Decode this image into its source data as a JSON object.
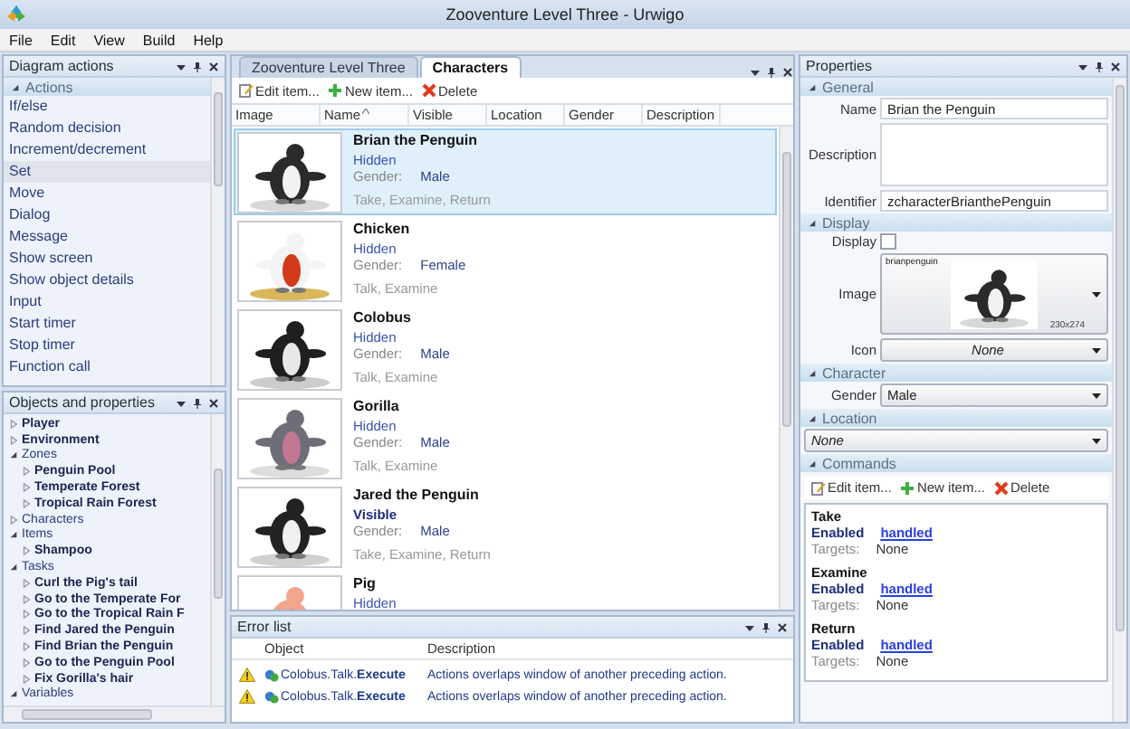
{
  "window": {
    "title": "Zooventure Level Three - Urwigo"
  },
  "menu": [
    "File",
    "Edit",
    "View",
    "Build",
    "Help"
  ],
  "diagram_actions": {
    "title": "Diagram actions",
    "section": {
      "label": "Actions",
      "expanded": true
    },
    "items": [
      {
        "label": "If/else",
        "selected": false
      },
      {
        "label": "Random decision",
        "selected": false
      },
      {
        "label": "Increment/decrement",
        "selected": false
      },
      {
        "label": "Set",
        "selected": true
      },
      {
        "label": "Move",
        "selected": false
      },
      {
        "label": "Dialog",
        "selected": false
      },
      {
        "label": "Message",
        "selected": false
      },
      {
        "label": "Show screen",
        "selected": false
      },
      {
        "label": "Show object details",
        "selected": false
      },
      {
        "label": "Input",
        "selected": false
      },
      {
        "label": "Start timer",
        "selected": false
      },
      {
        "label": "Stop timer",
        "selected": false
      },
      {
        "label": "Function call",
        "selected": false
      }
    ]
  },
  "objects": {
    "title": "Objects and properties",
    "tree": [
      {
        "label": "Player",
        "kind": "object",
        "expanded": false
      },
      {
        "label": "Environment",
        "kind": "object",
        "expanded": false
      },
      {
        "label": "Zones",
        "kind": "group",
        "expanded": true,
        "children": [
          {
            "label": "Penguin Pool",
            "kind": "object",
            "expanded": false
          },
          {
            "label": "Temperate Forest",
            "kind": "object",
            "expanded": false
          },
          {
            "label": "Tropical Rain Forest",
            "kind": "object",
            "expanded": false
          }
        ]
      },
      {
        "label": "Characters",
        "kind": "group",
        "expanded": false
      },
      {
        "label": "Items",
        "kind": "group",
        "expanded": true,
        "children": [
          {
            "label": "Shampoo",
            "kind": "object",
            "expanded": false
          }
        ]
      },
      {
        "label": "Tasks",
        "kind": "group",
        "expanded": true,
        "children": [
          {
            "label": "Curl the Pig's tail",
            "kind": "object",
            "expanded": false
          },
          {
            "label": "Go to the Temperate For",
            "kind": "object",
            "expanded": false
          },
          {
            "label": "Go to the Tropical Rain F",
            "kind": "object",
            "expanded": false
          },
          {
            "label": "Find Jared the Penguin",
            "kind": "object",
            "expanded": false
          },
          {
            "label": "Find Brian the Penguin",
            "kind": "object",
            "expanded": false
          },
          {
            "label": "Go to the Penguin Pool",
            "kind": "object",
            "expanded": false
          },
          {
            "label": "Fix Gorilla's hair",
            "kind": "object",
            "expanded": false
          }
        ]
      },
      {
        "label": "Variables",
        "kind": "group",
        "expanded": true
      }
    ]
  },
  "document": {
    "tabs": [
      {
        "label": "Zooventure Level Three",
        "selected": false
      },
      {
        "label": "Characters",
        "selected": true
      }
    ],
    "toolbar": [
      {
        "label": "Edit item...",
        "kind": "edit"
      },
      {
        "label": "New item...",
        "kind": "new"
      },
      {
        "label": "Delete",
        "kind": "delete"
      }
    ],
    "columns": [
      {
        "label": "Image",
        "sorted": false
      },
      {
        "label": "Name",
        "sorted": true
      },
      {
        "label": "Visible",
        "sorted": false
      },
      {
        "label": "Location",
        "sorted": false
      },
      {
        "label": "Gender",
        "sorted": false
      },
      {
        "label": "Description",
        "sorted": false
      }
    ],
    "rows": [
      {
        "name": "Brian the Penguin",
        "status": "Hidden",
        "visible": false,
        "gender_label": "Gender:",
        "gender": "Male",
        "commands": "Take, Examine, Return",
        "selected": true
      },
      {
        "name": "Chicken",
        "status": "Hidden",
        "visible": false,
        "gender_label": "Gender:",
        "gender": "Female",
        "commands": "Talk, Examine",
        "selected": false
      },
      {
        "name": "Colobus",
        "status": "Hidden",
        "visible": false,
        "gender_label": "Gender:",
        "gender": "Male",
        "commands": "Talk, Examine",
        "selected": false
      },
      {
        "name": "Gorilla",
        "status": "Hidden",
        "visible": false,
        "gender_label": "Gender:",
        "gender": "Male",
        "commands": "Talk, Examine",
        "selected": false
      },
      {
        "name": "Jared the Penguin",
        "status": "Visible",
        "visible": true,
        "gender_label": "Gender:",
        "gender": "Male",
        "commands": "Take, Examine, Return",
        "selected": false
      },
      {
        "name": "Pig",
        "status": "Hidden",
        "visible": false,
        "selected": false
      }
    ]
  },
  "error_list": {
    "title": "Error list",
    "columns": [
      "Object",
      "Description"
    ],
    "rows": [
      {
        "kind": "warning",
        "object": "Colobus.Talk.**Execute**",
        "description": "Actions overlaps window of another preceding action."
      },
      {
        "kind": "warning",
        "object": "Colobus.Talk.**Execute**",
        "description": "Actions overlaps window of another preceding action."
      }
    ]
  },
  "properties": {
    "title": "Properties",
    "sections": [
      {
        "label": "General",
        "expanded": true,
        "fields": [
          {
            "kind": "text",
            "label": "Name",
            "value": "Brian the Penguin"
          },
          {
            "kind": "multiline",
            "label": "Description"
          },
          {
            "kind": "text",
            "label": "Identifier",
            "value": "zcharacterBrianthePenguin"
          }
        ]
      },
      {
        "label": "Display",
        "expanded": true,
        "fields": [
          {
            "kind": "checkbox",
            "label": "Display",
            "checked": false
          },
          {
            "label": "Image",
            "caption": "brianpenguin",
            "size": "230x274"
          },
          {
            "kind": "dropdown",
            "label": "Icon",
            "value": "None",
            "italic": true
          }
        ]
      },
      {
        "label": "Character",
        "expanded": true,
        "fields": [
          {
            "kind": "dropdown",
            "label": "Gender",
            "value": "Male"
          }
        ]
      },
      {
        "label": "Location",
        "expanded": true,
        "fields": [
          {
            "kind": "dropdown",
            "value": "None",
            "italic": true
          }
        ]
      },
      {
        "label": "Commands",
        "expanded": true,
        "fields": [
          {
            "kind": "toolbar",
            "buttons": [
              {
                "label": "Edit item...",
                "kind": "edit"
              },
              {
                "label": "New item...",
                "kind": "new"
              },
              {
                "label": "Delete",
                "kind": "delete"
              }
            ]
          },
          {
            "kind": "commands",
            "items": [
              {
                "name": "Take",
                "enabled_label": "Enabled",
                "handler": "handled",
                "targets_label": "Targets:",
                "targets": "None"
              },
              {
                "name": "Examine",
                "enabled_label": "Enabled",
                "handler": "handled",
                "targets_label": "Targets:",
                "targets": "None"
              },
              {
                "name": "Return",
                "enabled_label": "Enabled",
                "handler": "handled",
                "targets_label": "Targets:",
                "targets": "None"
              }
            ]
          }
        ]
      }
    ]
  }
}
